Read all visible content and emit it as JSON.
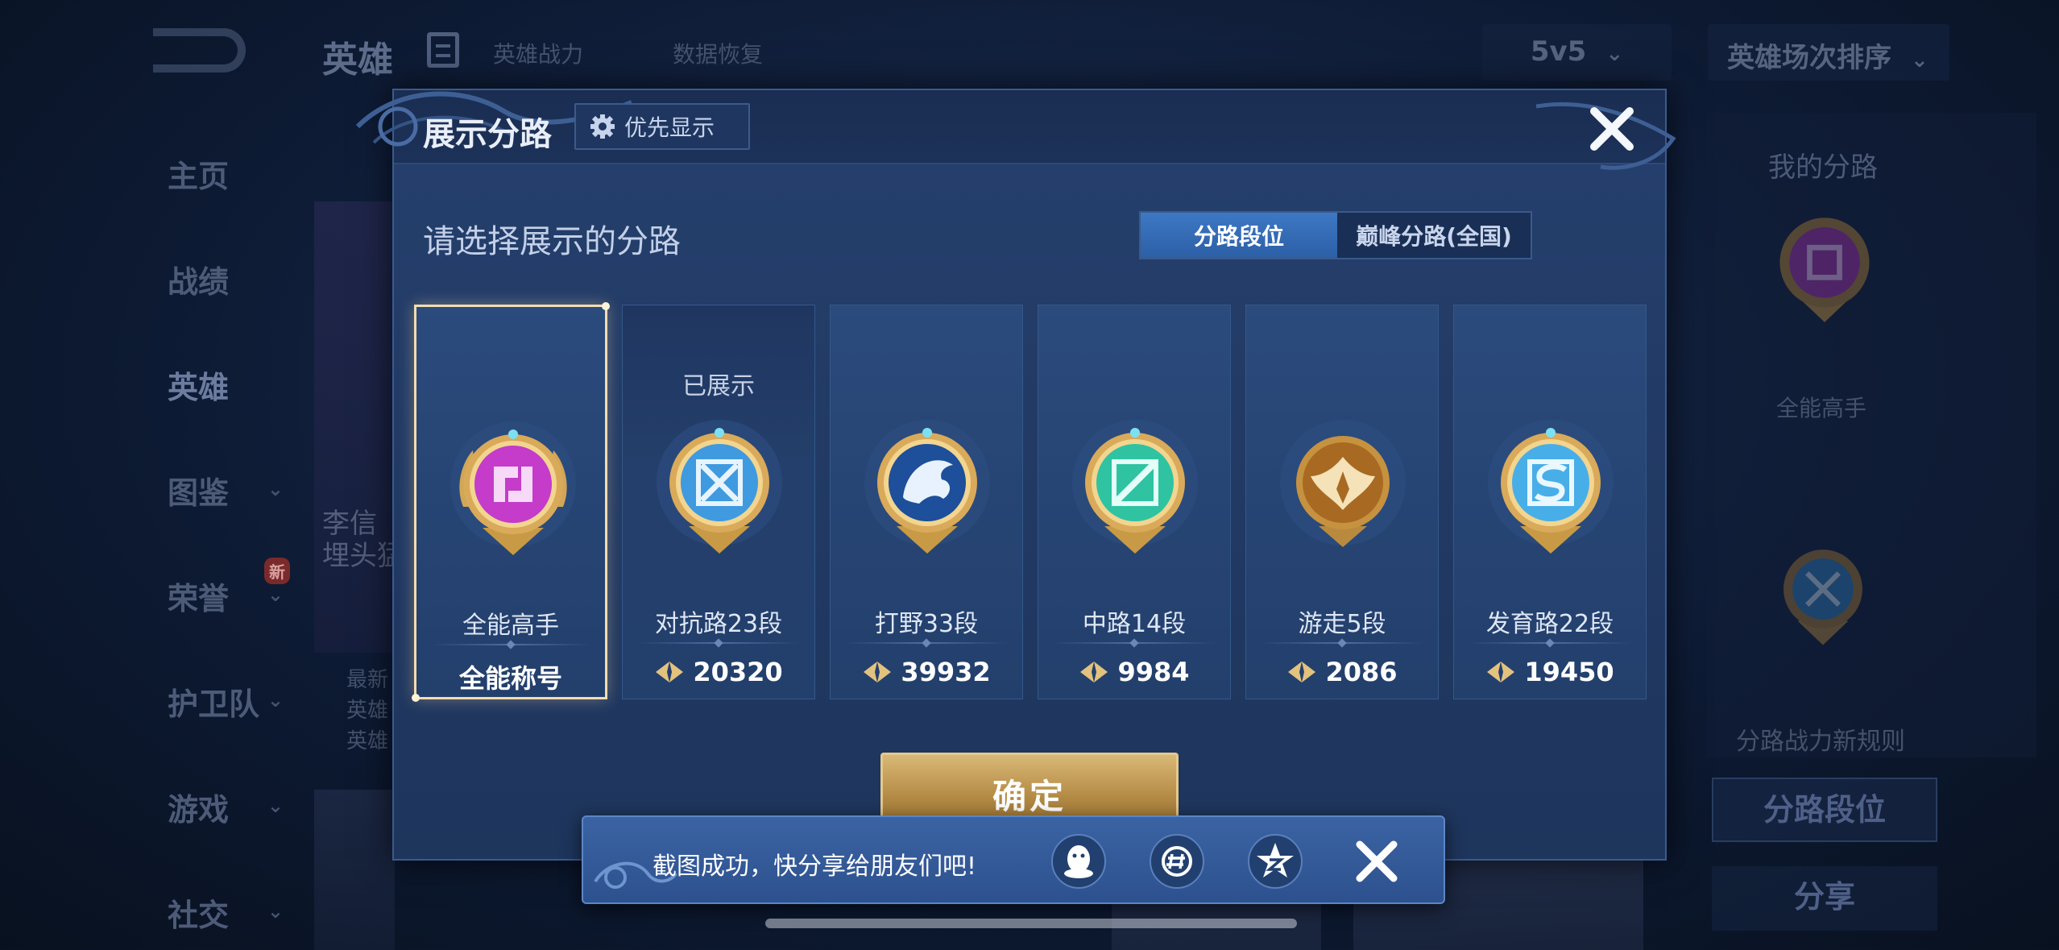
{
  "background": {
    "title": "英雄",
    "hero_power_label": "英雄战力",
    "data_restore_label": "数据恢复",
    "mode_select": "5v5",
    "sort_select": "英雄场次排序",
    "sidebar": [
      {
        "label": "主页",
        "has_chevron": false
      },
      {
        "label": "战绩",
        "has_chevron": false
      },
      {
        "label": "英雄",
        "has_chevron": false
      },
      {
        "label": "图鉴",
        "has_chevron": true
      },
      {
        "label": "荣誉",
        "has_chevron": true,
        "badge": "新"
      },
      {
        "label": "护卫队",
        "has_chevron": true
      },
      {
        "label": "游戏",
        "has_chevron": true
      },
      {
        "label": "社交",
        "has_chevron": true
      }
    ],
    "left_card_text": [
      "李信",
      "埋头猛"
    ],
    "left_info_text": [
      "最新",
      "英雄",
      "英雄"
    ],
    "right_panel": {
      "title": "我的分路",
      "emblem_name": "全能高手",
      "rule_text": "分路战力新规则",
      "lane_rank_button": "分路段位",
      "share_button": "分享"
    }
  },
  "modal": {
    "title": "展示分路",
    "priority_button": "优先显示",
    "subtitle": "请选择展示的分路",
    "tabs": [
      {
        "label": "分路段位",
        "active": true
      },
      {
        "label": "巅峰分路(全国)",
        "active": false
      }
    ],
    "cards": [
      {
        "name": "全能高手",
        "status": "",
        "footer": "全能称号",
        "score": null,
        "emblem": "all-rounder-emblem",
        "color": "#c03fc8",
        "selected": true
      },
      {
        "name": "对抗路23段",
        "status": "已展示",
        "footer": "20320",
        "score": 20320,
        "emblem": "clash-lane-emblem",
        "color": "#3f9ae0",
        "selected": false
      },
      {
        "name": "打野33段",
        "status": "",
        "footer": "39932",
        "score": 39932,
        "emblem": "jungle-emblem",
        "color": "#2f6fc4",
        "selected": false
      },
      {
        "name": "中路14段",
        "status": "",
        "footer": "9984",
        "score": 9984,
        "emblem": "mid-lane-emblem",
        "color": "#2fc3a2",
        "selected": false
      },
      {
        "name": "游走5段",
        "status": "",
        "footer": "2086",
        "score": 2086,
        "emblem": "roam-emblem",
        "color": "#d9a04a",
        "selected": false
      },
      {
        "name": "发育路22段",
        "status": "",
        "footer": "19450",
        "score": 19450,
        "emblem": "farm-lane-emblem",
        "color": "#48aee8",
        "selected": false
      }
    ],
    "confirm_button": "确定"
  },
  "toast": {
    "message": "截图成功，快分享给朋友们吧!",
    "share_targets": [
      "qq-icon",
      "wechat-moments-icon",
      "qzone-icon"
    ]
  }
}
